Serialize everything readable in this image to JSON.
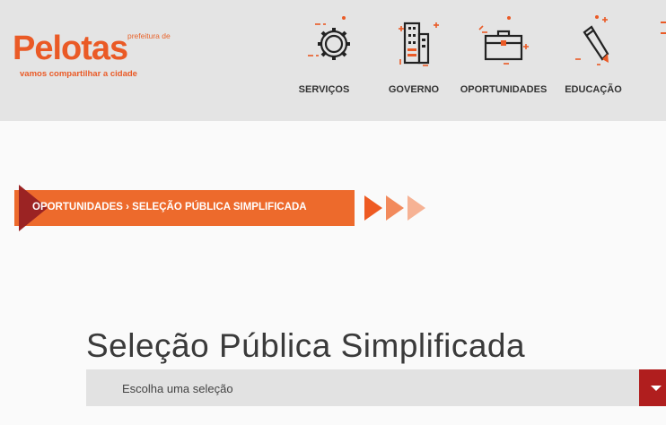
{
  "brand": {
    "prefix": "prefeitura de",
    "name": "Pelotas",
    "tagline": "vamos compartilhar a cidade",
    "accent": "#ea5a26",
    "dark_accent": "#9b2323"
  },
  "nav": {
    "items": [
      {
        "label": "SERVIÇOS",
        "icon": "gear-icon"
      },
      {
        "label": "GOVERNO",
        "icon": "building-icon"
      },
      {
        "label": "OPORTUNIDADES",
        "icon": "briefcase-icon"
      },
      {
        "label": "EDUCAÇÃO",
        "icon": "pencil-icon"
      }
    ]
  },
  "breadcrumb": {
    "text": "OPORTUNIDADES › SELEÇÃO PÚBLICA SIMPLIFICADA"
  },
  "page": {
    "title": "Seleção Pública Simplificada"
  },
  "selection": {
    "value": "Escolha uma seleção"
  }
}
